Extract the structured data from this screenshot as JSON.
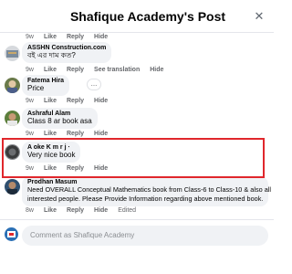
{
  "header": {
    "title": "Shafique Academy's Post",
    "close_icon": "close-icon"
  },
  "top_meta": {
    "time": "9w",
    "like": "Like",
    "reply": "Reply",
    "hide": "Hide"
  },
  "comments": [
    {
      "author": "ASSHN Construction.com",
      "text": "বই এর দাম কত?",
      "time": "9w",
      "like": "Like",
      "reply": "Reply",
      "extra": "See translation",
      "hide": "Hide"
    },
    {
      "author": "Fatema Hira",
      "text": "Price",
      "more": "...",
      "time": "9w",
      "like": "Like",
      "reply": "Reply",
      "hide": "Hide"
    },
    {
      "author": "Ashraful Alam",
      "text": "Class 8 ar book asa",
      "time": "9w",
      "like": "Like",
      "reply": "Reply",
      "hide": "Hide"
    },
    {
      "author": "A oke K m r j ∙",
      "text": "Very nice  book",
      "time": "9w",
      "like": "Like",
      "reply": "Reply",
      "hide": "Hide"
    },
    {
      "author": "Prodhan Masum",
      "text1": "Need OVERALL Conceptual Mathematics book from Class-6 to Class-10 & also all",
      "text2": "interested people. Please Provide Information regarding above mentioned book.",
      "time": "8w",
      "like": "Like",
      "reply": "Reply",
      "hide": "Hide",
      "edited": "Edited"
    }
  ],
  "composer": {
    "placeholder": "Comment as Shafique Academy"
  },
  "colors": {
    "highlight": "#e0272c",
    "bubble": "#f0f2f5",
    "meta": "#65676b"
  }
}
